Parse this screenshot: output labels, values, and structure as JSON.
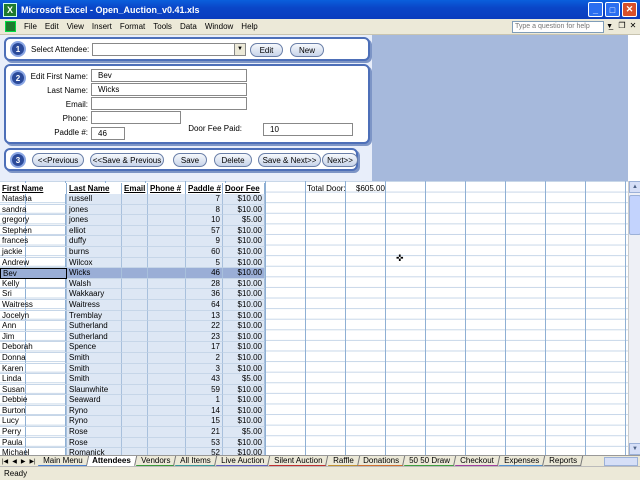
{
  "window": {
    "title": "Microsoft Excel - Open_Auction_v0.41.xls",
    "icon": "excel-icon"
  },
  "menu": [
    "File",
    "Edit",
    "View",
    "Insert",
    "Format",
    "Tools",
    "Data",
    "Window",
    "Help"
  ],
  "ask_placeholder": "Type a question for help",
  "form": {
    "step1": {
      "num": "1",
      "label": "Select Attendee:",
      "value": "",
      "edit_label": "Edit",
      "new_label": "New"
    },
    "step2": {
      "num": "2",
      "first_name_label": "Edit First Name:",
      "first_name": "Bev",
      "last_name_label": "Last Name:",
      "last_name": "Wicks",
      "email_label": "Email:",
      "email": "",
      "phone_label": "Phone:",
      "phone": "",
      "paddle_label": "Paddle #:",
      "paddle": "46",
      "door_fee_label": "Door Fee Paid:",
      "door_fee": "10"
    },
    "step3": {
      "num": "3",
      "buttons": [
        "<<Previous",
        "<<Save & Previous",
        "Save",
        "Delete",
        "Save & Next>>",
        "Next>>"
      ]
    }
  },
  "table": {
    "headers": [
      "First Name",
      "Last Name",
      "Email",
      "Phone #",
      "Paddle #",
      "Door Fee"
    ],
    "total_label": "Total Door:",
    "total_value": "$605.00",
    "selected_index": 7,
    "rows": [
      [
        "Natasha",
        "russell",
        "",
        "",
        "7",
        "$10.00"
      ],
      [
        "sandra",
        "jones",
        "",
        "",
        "8",
        "$10.00"
      ],
      [
        "gregory",
        "jones",
        "",
        "",
        "10",
        "$5.00"
      ],
      [
        "Stephen",
        "elliot",
        "",
        "",
        "57",
        "$10.00"
      ],
      [
        "frances",
        "duffy",
        "",
        "",
        "9",
        "$10.00"
      ],
      [
        "jackie",
        "burns",
        "",
        "",
        "60",
        "$10.00"
      ],
      [
        "Andrew",
        "Wilcox",
        "",
        "",
        "5",
        "$10.00"
      ],
      [
        "Bev",
        "Wicks",
        "",
        "",
        "46",
        "$10.00"
      ],
      [
        "Kelly",
        "Walsh",
        "",
        "",
        "28",
        "$10.00"
      ],
      [
        "Sri",
        "Wakkaary",
        "",
        "",
        "36",
        "$10.00"
      ],
      [
        "Waitress",
        "Waitress",
        "",
        "",
        "64",
        "$10.00"
      ],
      [
        "Jocelyn",
        "Tremblay",
        "",
        "",
        "13",
        "$10.00"
      ],
      [
        "Ann",
        "Sutherland",
        "",
        "",
        "22",
        "$10.00"
      ],
      [
        "Jim",
        "Sutherland",
        "",
        "",
        "23",
        "$10.00"
      ],
      [
        "Deborah",
        "Spence",
        "",
        "",
        "17",
        "$10.00"
      ],
      [
        "Donna",
        "Smith",
        "",
        "",
        "2",
        "$10.00"
      ],
      [
        "Karen",
        "Smith",
        "",
        "",
        "3",
        "$10.00"
      ],
      [
        "Linda",
        "Smith",
        "",
        "",
        "43",
        "$5.00"
      ],
      [
        "Susan",
        "Slaunwhite",
        "",
        "",
        "59",
        "$10.00"
      ],
      [
        "Debbie",
        "Seaward",
        "",
        "",
        "1",
        "$10.00"
      ],
      [
        "Burton",
        "Ryno",
        "",
        "",
        "14",
        "$10.00"
      ],
      [
        "Lucy",
        "Ryno",
        "",
        "",
        "15",
        "$10.00"
      ],
      [
        "Perry",
        "Rose",
        "",
        "",
        "21",
        "$5.00"
      ],
      [
        "Paula",
        "Rose",
        "",
        "",
        "53",
        "$10.00"
      ],
      [
        "Michael",
        "Romanick",
        "",
        "",
        "52",
        "$10.00"
      ]
    ]
  },
  "sheet_tabs": [
    "Main Menu",
    "Attendees",
    "Vendors",
    "All Items",
    "Live Auction",
    "Silent Auction",
    "Raffle",
    "Donations",
    "50 50 Draw",
    "Checkout",
    "Expenses",
    "Reports"
  ],
  "active_tab": "Attendees",
  "tab_colors": [
    "#4a7fd0",
    "#ffffff",
    "#3a9a3a",
    "#3a9a9a",
    "#6060c0",
    "#c03030",
    "#c09030",
    "#d07030",
    "#40a040",
    "#a040a0",
    "#5090d0",
    "#808080"
  ],
  "status": "Ready"
}
